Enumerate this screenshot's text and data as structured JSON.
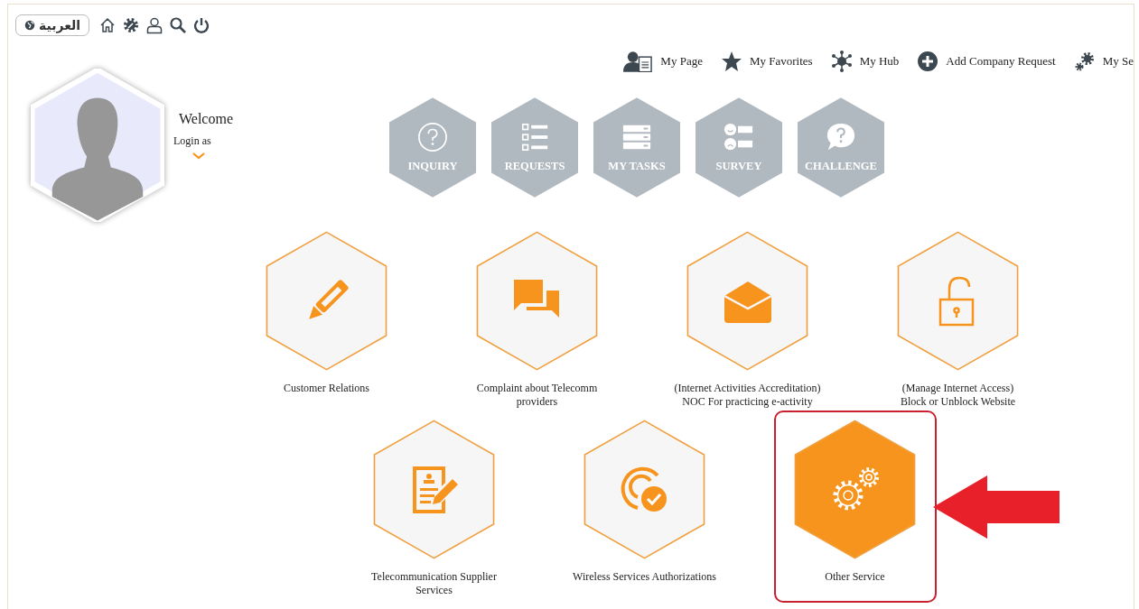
{
  "toolbar": {
    "language_button": "العربية"
  },
  "profile": {
    "greeting": "Welcome",
    "login_label": "Login as"
  },
  "nav_links": [
    {
      "kind": "page",
      "label": "My Page"
    },
    {
      "kind": "favorites",
      "label": "My Favorites"
    },
    {
      "kind": "hub",
      "label": "My Hub"
    },
    {
      "kind": "add",
      "label": "Add Company Request"
    },
    {
      "kind": "settings",
      "label": "My Se"
    }
  ],
  "quick_actions": [
    {
      "kind": "inquiry",
      "label": "INQUIRY"
    },
    {
      "kind": "requests",
      "label": "REQUESTS"
    },
    {
      "kind": "tasks",
      "label": "MY TASKS"
    },
    {
      "kind": "survey",
      "label": "SURVEY"
    },
    {
      "kind": "challenge",
      "label": "CHALLENGE"
    }
  ],
  "service_rows": [
    [
      {
        "kind": "edit",
        "lines": [
          "Customer Relations"
        ],
        "highlighted": false
      },
      {
        "kind": "chat",
        "lines": [
          "Complaint about Telecomm",
          "providers"
        ],
        "highlighted": false
      },
      {
        "kind": "mail",
        "lines": [
          "(Internet Activities Accreditation)",
          "NOC For practicing e-activity"
        ],
        "highlighted": false
      },
      {
        "kind": "lock",
        "lines": [
          "(Manage Internet Access)",
          "Block or Unblock Website"
        ],
        "highlighted": false
      }
    ],
    [
      {
        "kind": "document",
        "lines": [
          "Telecommunication Supplier",
          "Services"
        ],
        "highlighted": false
      },
      {
        "kind": "wireless",
        "lines": [
          "Wireless Services Authorizations"
        ],
        "highlighted": false
      },
      {
        "kind": "gears",
        "lines": [
          "Other Service"
        ],
        "highlighted": true
      }
    ]
  ]
}
